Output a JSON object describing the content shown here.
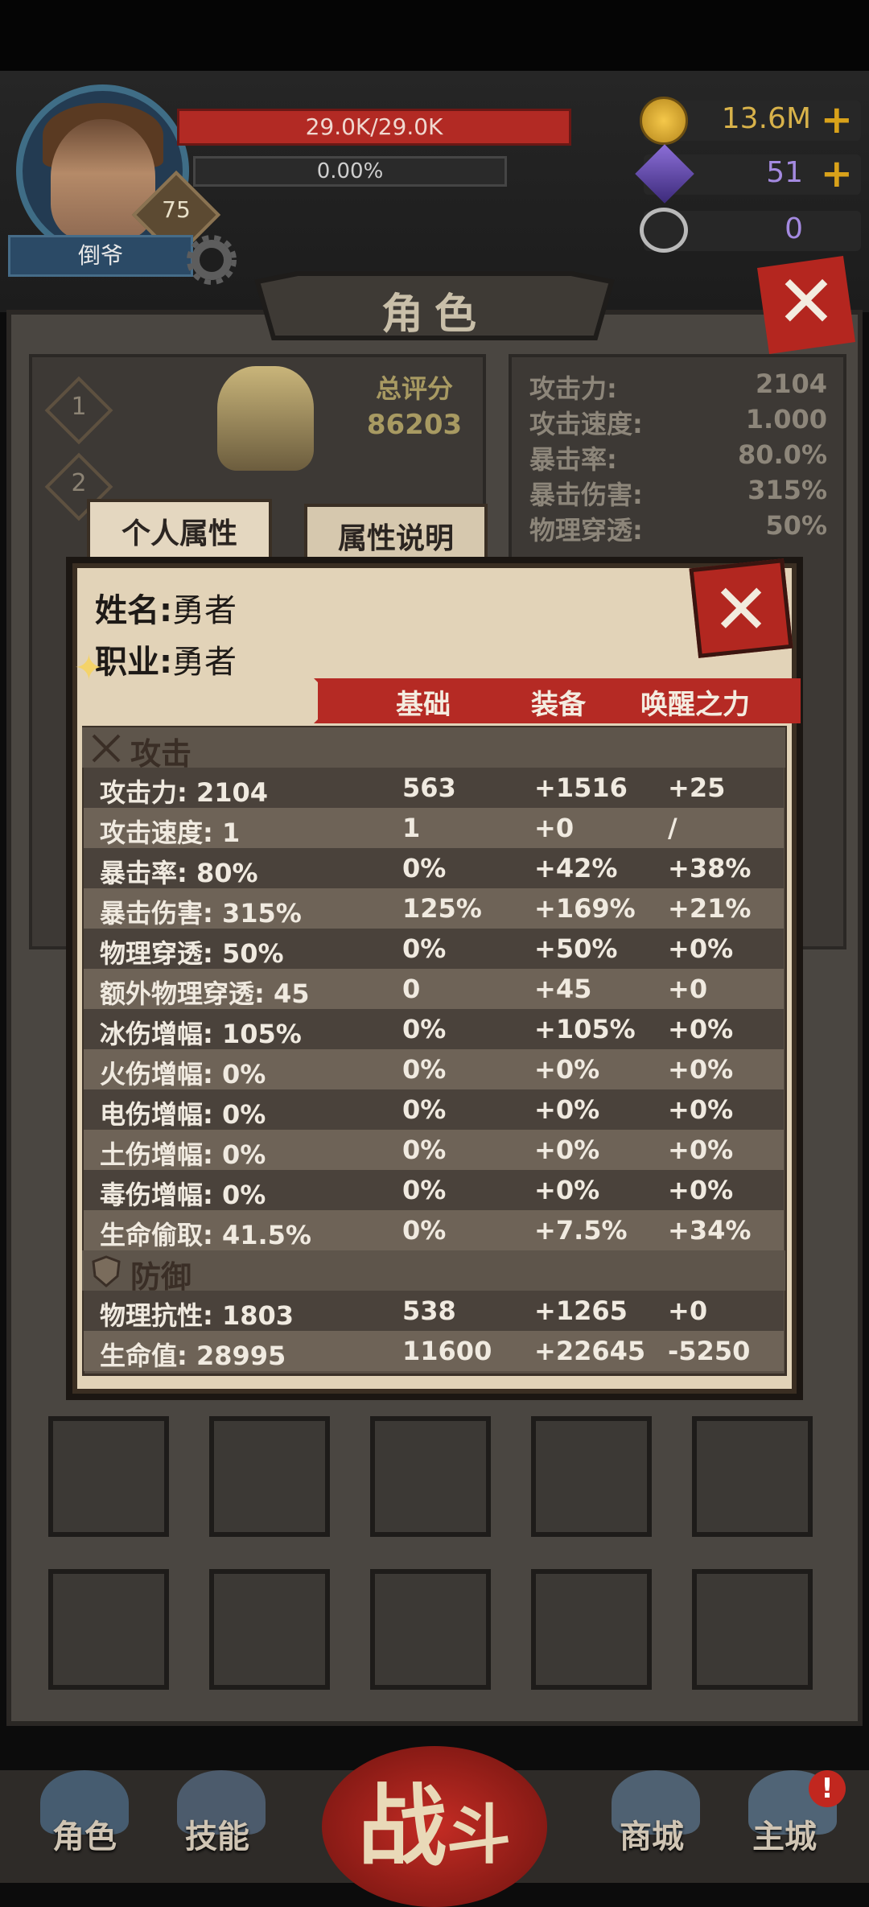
{
  "hud": {
    "hp": "29.0K/29.0K",
    "xp_percent": "0.00%",
    "xp_fill": 0.0,
    "level": "75",
    "player_name": "倒爷",
    "gold": "13.6M",
    "gems": "51",
    "tokens": "0"
  },
  "role_panel": {
    "title": "角色",
    "rank_1": "1",
    "rank_2": "2",
    "score_label": "总评分",
    "score_value": "86203",
    "summary": [
      {
        "k": "攻击力:",
        "v": "2104"
      },
      {
        "k": "攻击速度:",
        "v": "1.000"
      },
      {
        "k": "暴击率:",
        "v": "80.0%"
      },
      {
        "k": "暴击伤害:",
        "v": "315%"
      },
      {
        "k": "物理穿透:",
        "v": "50%"
      }
    ]
  },
  "tabs": {
    "personal": "个人属性",
    "description": "属性说明"
  },
  "dialog": {
    "name_label": "姓名:",
    "name_value": "勇者",
    "class_label": "职业:",
    "class_value": "勇者",
    "col_base": "基础",
    "col_equip": "装备",
    "col_awaken": "唤醒之力",
    "section_attack": "攻击",
    "section_defense": "防御",
    "attack_rows": [
      {
        "name": "攻击力: 2104",
        "base": "563",
        "equip": "+1516",
        "awaken": "+25"
      },
      {
        "name": "攻击速度: 1",
        "base": "1",
        "equip": "+0",
        "awaken": "/"
      },
      {
        "name": "暴击率: 80%",
        "base": "0%",
        "equip": "+42%",
        "awaken": "+38%"
      },
      {
        "name": "暴击伤害: 315%",
        "base": "125%",
        "equip": "+169%",
        "awaken": "+21%"
      },
      {
        "name": "物理穿透: 50%",
        "base": "0%",
        "equip": "+50%",
        "awaken": "+0%"
      },
      {
        "name": "额外物理穿透: 45",
        "base": "0",
        "equip": "+45",
        "awaken": "+0"
      },
      {
        "name": "冰伤增幅: 105%",
        "base": "0%",
        "equip": "+105%",
        "awaken": "+0%"
      },
      {
        "name": "火伤增幅: 0%",
        "base": "0%",
        "equip": "+0%",
        "awaken": "+0%"
      },
      {
        "name": "电伤增幅: 0%",
        "base": "0%",
        "equip": "+0%",
        "awaken": "+0%"
      },
      {
        "name": "土伤增幅: 0%",
        "base": "0%",
        "equip": "+0%",
        "awaken": "+0%"
      },
      {
        "name": "毒伤增幅: 0%",
        "base": "0%",
        "equip": "+0%",
        "awaken": "+0%"
      },
      {
        "name": "生命偷取: 41.5%",
        "base": "0%",
        "equip": "+7.5%",
        "awaken": "+34%"
      }
    ],
    "defense_rows": [
      {
        "name": "物理抗性: 1803",
        "base": "538",
        "equip": "+1265",
        "awaken": "+0"
      },
      {
        "name": "生命值: 28995",
        "base": "11600",
        "equip": "+22645",
        "awaken": "-5250"
      }
    ]
  },
  "nav": {
    "role": "角色",
    "skills": "技能",
    "battle_1": "战",
    "battle_2": "斗",
    "shop": "商城",
    "city": "主城",
    "city_badge": "!"
  },
  "colors": {
    "accent_red": "#b52a24",
    "hp_red": "#b22a24",
    "parchment": "#e2d3b8",
    "gold": "#d9a21a"
  }
}
